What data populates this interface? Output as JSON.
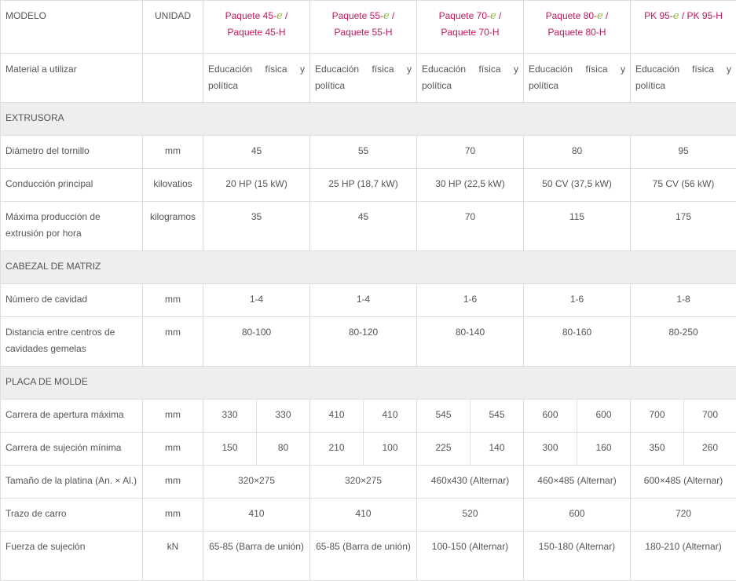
{
  "header": {
    "modelo": "MODELO",
    "unidad": "UNIDAD",
    "models": [
      {
        "pre": "Paquete 45-",
        "e": "e",
        "post": "/",
        "line2": "Paquete 45-H"
      },
      {
        "pre": "Paquete 55-",
        "e": "e",
        "post": "/",
        "line2": "Paquete 55-H"
      },
      {
        "pre": "Paquete 70-",
        "e": "e",
        "post": "/",
        "line2": "Paquete 70-H"
      },
      {
        "pre": "Paquete 80-",
        "e": "e",
        "post": "/",
        "line2": "Paquete 80-H"
      },
      {
        "pre": "PK 95-",
        "e": "e",
        "post": "/ PK 95-H",
        "line2": ""
      }
    ]
  },
  "material": {
    "label": "Material a utilizar",
    "unit": "",
    "values": [
      "Educación física y política",
      "Educación física y política",
      "Educación física y política",
      "Educación física y política",
      "Educación física y política"
    ]
  },
  "sections": {
    "extrusora": "EXTRUSORA",
    "cabezal": "CABEZAL DE MATRIZ",
    "placa": "PLACA DE MOLDE"
  },
  "rows": {
    "diametro": {
      "label": "Diámetro del tornillo",
      "unit": "mm",
      "values": [
        "45",
        "55",
        "70",
        "80",
        "95"
      ]
    },
    "conduccion": {
      "label": "Conducción principal",
      "unit": "kilovatios",
      "values": [
        "20 HP (15 kW)",
        "25 HP (18,7 kW)",
        "30 HP (22,5 kW)",
        "50 CV (37,5 kW)",
        "75 CV (56 kW)"
      ]
    },
    "produccion": {
      "label": "Máxima producción de extrusión por hora",
      "unit": "kilogramos",
      "values": [
        "35",
        "45",
        "70",
        "115",
        "175"
      ]
    },
    "cavidad": {
      "label": "Número de cavidad",
      "unit": "mm",
      "values": [
        "1-4",
        "1-4",
        "1-6",
        "1-6",
        "1-8"
      ]
    },
    "distancia": {
      "label": "Distancia entre centros de cavidades gemelas",
      "unit": "mm",
      "values": [
        "80-100",
        "80-120",
        "80-140",
        "80-160",
        "80-250"
      ]
    },
    "apertura": {
      "label": "Carrera de apertura máxima",
      "unit": "mm",
      "values": [
        "330",
        "330",
        "410",
        "410",
        "545",
        "545",
        "600",
        "600",
        "700",
        "700"
      ]
    },
    "sujecion_min": {
      "label": "Carrera de sujeción mínima",
      "unit": "mm",
      "values": [
        "150",
        "80",
        "210",
        "100",
        "225",
        "140",
        "300",
        "160",
        "350",
        "260"
      ]
    },
    "platina": {
      "label": "Tamaño de la platina (An. × Al.)",
      "unit": "mm",
      "values": [
        "320×275",
        "320×275",
        "460x430 (Alternar)",
        "460×485 (Alternar)",
        "600×485 (Alternar)"
      ]
    },
    "carro": {
      "label": "Trazo de carro",
      "unit": "mm",
      "values": [
        "410",
        "410",
        "520",
        "600",
        "720"
      ]
    },
    "fuerza": {
      "label": "Fuerza de sujeción",
      "unit": "kN",
      "values": [
        "65-85 (Barra de unión)",
        "65-85 (Barra de unión)",
        "100-150 (Alternar)",
        "150-180 (Alternar)",
        "180-210 (Alternar)"
      ]
    }
  }
}
